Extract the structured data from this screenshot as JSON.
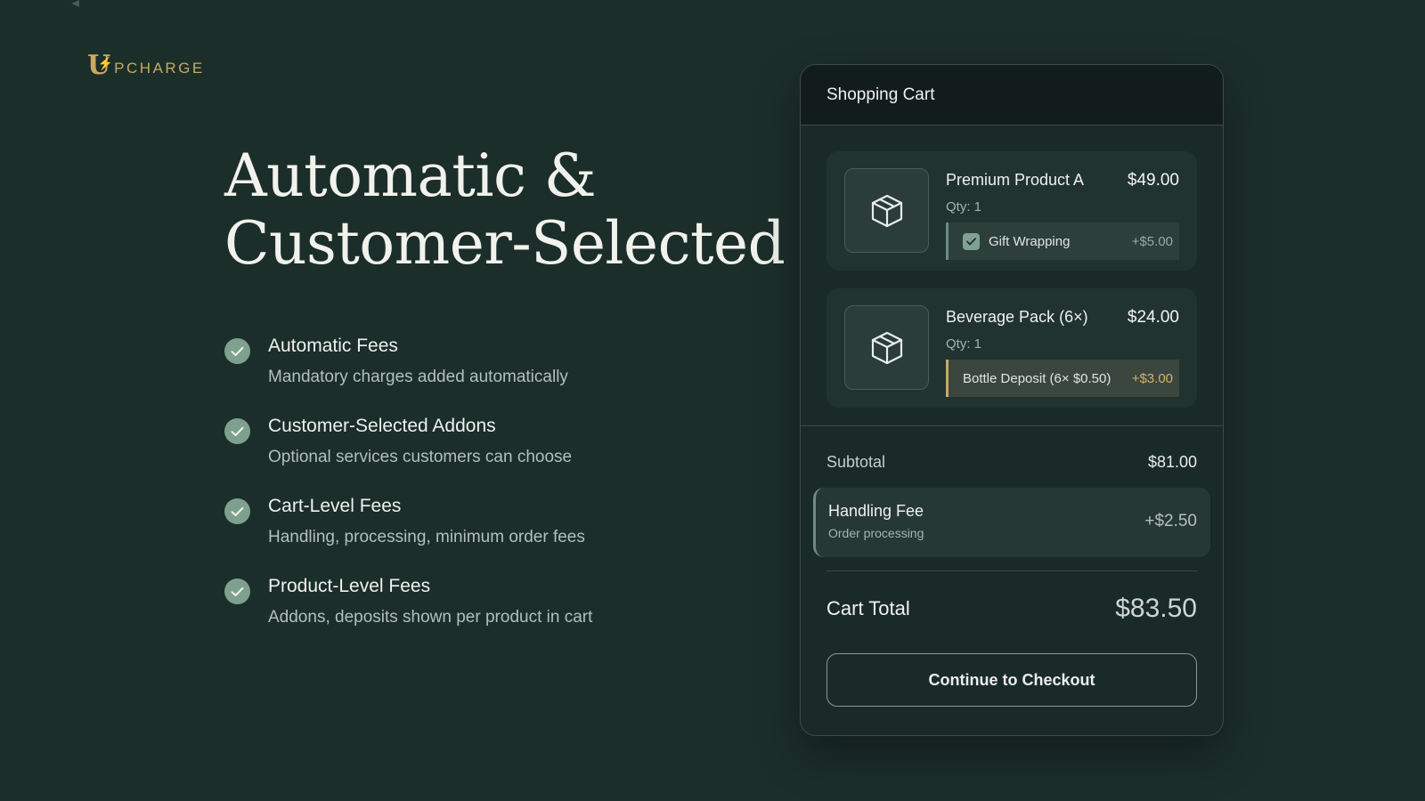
{
  "brand": {
    "logo_letter": "U",
    "logo_text": "PCHARGE",
    "color": "#c9a961"
  },
  "headline": {
    "line1": "Automatic &",
    "line2": "Customer-Selected"
  },
  "features": [
    {
      "title": "Automatic Fees",
      "desc": "Mandatory charges added automatically",
      "icon": "check-icon"
    },
    {
      "title": "Customer-Selected Addons",
      "desc": "Optional services customers can choose",
      "icon": "check-icon"
    },
    {
      "title": "Cart-Level Fees",
      "desc": "Handling, processing, minimum order fees",
      "icon": "check-icon"
    },
    {
      "title": "Product-Level Fees",
      "desc": "Addons, deposits shown per product in cart",
      "icon": "check-icon"
    }
  ],
  "cart": {
    "title": "Shopping Cart",
    "items": [
      {
        "name": "Premium Product A",
        "price": "$49.00",
        "qty": "Qty: 1",
        "icon": "package-icon",
        "addon": {
          "label": "Gift Wrapping",
          "price": "+$5.00",
          "checked": true,
          "type": "optional"
        }
      },
      {
        "name": "Beverage Pack (6×)",
        "price": "$24.00",
        "qty": "Qty: 1",
        "icon": "package-icon",
        "addon": {
          "label": "Bottle Deposit (6× $0.50)",
          "price": "+$3.00",
          "type": "deposit"
        }
      }
    ],
    "subtotal_label": "Subtotal",
    "subtotal_value": "$81.00",
    "fee": {
      "title": "Handling Fee",
      "subtitle": "Order processing",
      "price": "+$2.50"
    },
    "total_label": "Cart Total",
    "total_value": "$83.50",
    "checkout_label": "Continue to Checkout"
  },
  "colors": {
    "background": "#1c2e2a",
    "accent_gold": "#c9a961",
    "accent_sage": "#80a08f"
  }
}
